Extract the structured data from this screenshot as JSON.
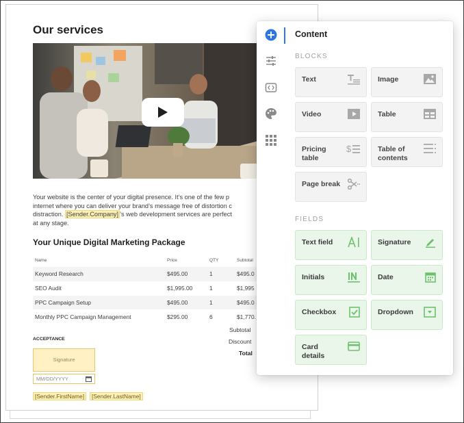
{
  "document": {
    "title": "Our services",
    "paragraph": {
      "line1": "Your website is the center of your digital presence. It’s one of the few p",
      "line2": "internet where you can deliver your brand’s message free of distortion c",
      "line3_before": "distraction. ",
      "line3_token": "[Sender.Company]",
      "line3_after": "’s web development services are perfect",
      "line4": "at any stage."
    },
    "package_heading": "Your Unique Digital Marketing Package",
    "pricing_table": {
      "headers": [
        "Name",
        "Price",
        "QTY",
        "Subtotal"
      ],
      "rows": [
        [
          "Keyword Research",
          "$495.00",
          "1",
          "$495.0"
        ],
        [
          "SEO Audit",
          "$1,995.00",
          "1",
          "$1,995"
        ],
        [
          "PPC Campaign Setup",
          "$495.00",
          "1",
          "$495.0"
        ],
        [
          "Monthly PPC Campaign Management",
          "$295.00",
          "6",
          "$1,770."
        ]
      ]
    },
    "summary": {
      "subtotal": "Subtotal",
      "discount": "Discount",
      "total": "Total"
    },
    "acceptance": {
      "heading": "ACCEPTANCE",
      "signature_placeholder": "Signature",
      "date_placeholder": "MM/DD/YYYY",
      "first_name_token": "[Sender.FirstName]",
      "last_name_token": "[Sender.LastName]"
    }
  },
  "panel": {
    "title": "Content",
    "rail": [
      {
        "name": "add-icon",
        "active": true
      },
      {
        "name": "sliders-icon"
      },
      {
        "name": "embed-icon"
      },
      {
        "name": "palette-icon"
      },
      {
        "name": "apps-grid-icon"
      }
    ],
    "blocks_label": "BLOCKS",
    "blocks": [
      {
        "label": "Text",
        "icon": "text-icon"
      },
      {
        "label": "Image",
        "icon": "image-icon"
      },
      {
        "label": "Video",
        "icon": "video-icon"
      },
      {
        "label": "Table",
        "icon": "table-icon"
      },
      {
        "label": "Pricing\ntable",
        "icon": "pricing-table-icon"
      },
      {
        "label": "Table of\ncontents",
        "icon": "table-of-contents-icon"
      },
      {
        "label": "Page break",
        "icon": "page-break-icon"
      }
    ],
    "fields_label": "FIELDS",
    "fields": [
      {
        "label": "Text field",
        "icon": "text-field-icon"
      },
      {
        "label": "Signature",
        "icon": "signature-pen-icon"
      },
      {
        "label": "Initials",
        "icon": "initials-icon"
      },
      {
        "label": "Date",
        "icon": "calendar-icon"
      },
      {
        "label": "Checkbox",
        "icon": "checkbox-icon"
      },
      {
        "label": "Dropdown",
        "icon": "dropdown-icon"
      },
      {
        "label": "Card\ndetails",
        "icon": "card-icon"
      }
    ]
  },
  "colors": {
    "accent": "#2d74e5",
    "token_highlight": "#fff1b3",
    "field_tile": "#eaf6ea",
    "field_icon": "#6cc16c",
    "block_tile": "#f3f3f3"
  }
}
